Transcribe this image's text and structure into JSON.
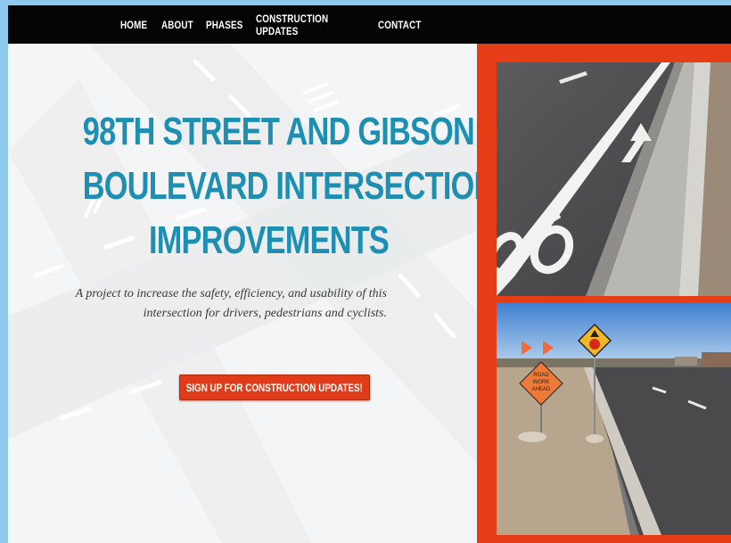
{
  "nav": {
    "items": [
      {
        "label": "HOME"
      },
      {
        "label": "ABOUT"
      },
      {
        "label": "PHASES"
      },
      {
        "label": "CONSTRUCTION UPDATES"
      },
      {
        "label": "CONTACT"
      }
    ]
  },
  "hero": {
    "title_lines": [
      "98TH STREET AND GIBSON",
      "BOULEVARD INTERSECTION",
      "IMPROVEMENTS"
    ],
    "tagline": "A project to increase the safety, efficiency, and usability of this intersection for drivers, pedestrians and cyclists.",
    "cta_label": "SIGN UP FOR CONSTRUCTION UPDATES!"
  },
  "photos": {
    "sign_text": [
      "ROAD",
      "WORK",
      "AHEAD"
    ]
  },
  "colors": {
    "nav_bg": "#050505",
    "title_blue": "#1d8fb3",
    "accent_orange": "#e63d16",
    "cta_red": "#e13c1a",
    "page_border": "#8ec9ee"
  }
}
